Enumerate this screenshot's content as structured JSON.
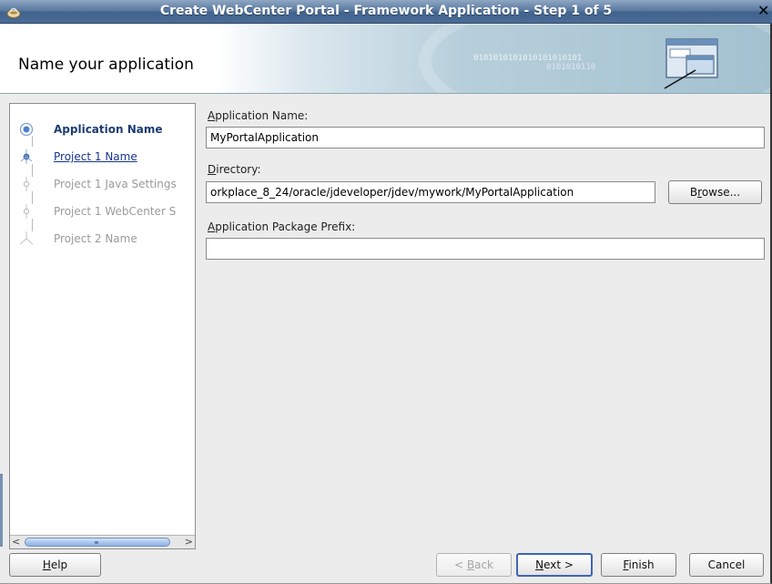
{
  "window": {
    "title": "Create WebCenter Portal - Framework Application - Step 1 of 5",
    "close_glyph": "✕"
  },
  "banner": {
    "heading": "Name your application",
    "binary_text": "0101010101010101010101",
    "binary_text2": "0101010110"
  },
  "steps": [
    {
      "label": "Application Name",
      "state": "current",
      "icon": "current-step-icon"
    },
    {
      "label": "Project 1 Name",
      "state": "link",
      "icon": "step-node-icon"
    },
    {
      "label": "Project 1 Java Settings",
      "state": "disabled",
      "icon": "step-node-icon"
    },
    {
      "label": "Project 1 WebCenter S",
      "state": "disabled",
      "icon": "step-node-icon"
    },
    {
      "label": "Project 2 Name",
      "state": "disabled",
      "icon": "step-end-icon"
    }
  ],
  "form": {
    "app_name": {
      "label_mn": "A",
      "label_rest": "pplication Name:",
      "value": "MyPortalApplication"
    },
    "directory": {
      "label_mn": "D",
      "label_rest": "irectory:",
      "value": "orkplace_8_24/oracle/jdeveloper/jdev/mywork/MyPortalApplication"
    },
    "prefix": {
      "label_mn": "A",
      "label_rest": "pplication Package Prefix:",
      "value": ""
    }
  },
  "buttons": {
    "browse": {
      "pre": "B",
      "mn": "r",
      "post": "owse..."
    },
    "help": {
      "pre": "",
      "mn": "H",
      "post": "elp"
    },
    "back": {
      "pre": "< ",
      "mn": "B",
      "post": "ack"
    },
    "next": {
      "pre": "",
      "mn": "N",
      "post": "ext >"
    },
    "finish": {
      "pre": "",
      "mn": "F",
      "post": "inish"
    },
    "cancel": {
      "pre": "Cancel",
      "mn": "",
      "post": ""
    }
  },
  "scrollbar": {
    "left_arrow": "<",
    "right_arrow": ">"
  }
}
